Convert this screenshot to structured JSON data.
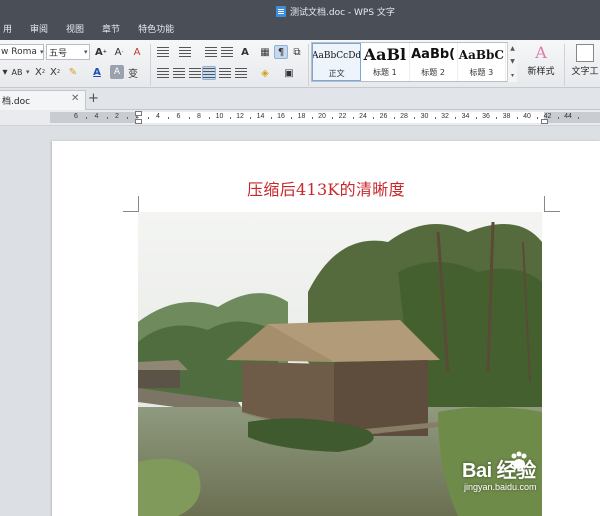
{
  "window": {
    "title": "测试文档.doc - WPS 文字"
  },
  "menu": {
    "items": [
      "用",
      "审阅",
      "视图",
      "章节",
      "特色功能"
    ]
  },
  "ribbon": {
    "font_name": "w Roma",
    "font_size": "五号",
    "styles": [
      {
        "sample": "AaBbCcDd",
        "label": "正文"
      },
      {
        "sample": "AaBl",
        "label": "标题 1"
      },
      {
        "sample": "AaBb(",
        "label": "标题 2"
      },
      {
        "sample": "AaBbC",
        "label": "标题 3"
      }
    ],
    "new_style_label": "新样式",
    "text_tools_label": "文字工"
  },
  "tabs": {
    "doc_label": "档.doc",
    "close_glyph": "✕",
    "add_glyph": "+"
  },
  "ruler": {
    "ticks": [
      "6",
      "4",
      "2",
      "2",
      "4",
      "6",
      "8",
      "10",
      "12",
      "14",
      "16",
      "18",
      "20",
      "22",
      "24",
      "26",
      "28",
      "30",
      "32",
      "34",
      "36",
      "38",
      "40",
      "42",
      "44"
    ]
  },
  "document": {
    "heading": "压缩后413K的清晰度"
  },
  "watermark": {
    "logo": "Bai 经验",
    "url": "jingyan.baidu.com"
  },
  "colors": {
    "titlebar": "#4a4f57",
    "heading": "#c8272b",
    "accent": "#3e8ede"
  }
}
